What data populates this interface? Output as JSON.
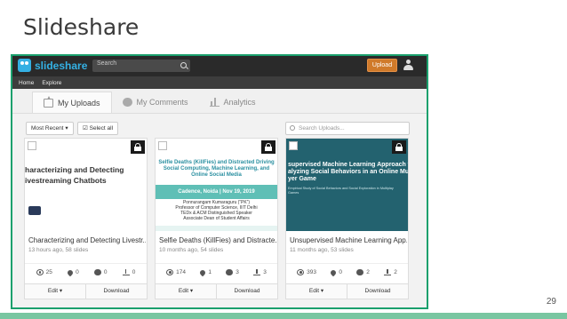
{
  "slide": {
    "title": "Slideshare",
    "page_number": "29"
  },
  "topbar": {
    "logo_text": "slideshare",
    "search_placeholder": "Search",
    "upload_label": "Upload"
  },
  "nav": {
    "items": [
      "Home",
      "Explore"
    ]
  },
  "tabs": [
    {
      "label": "My Uploads",
      "icon": "upload-icon",
      "active": true
    },
    {
      "label": "My Comments",
      "icon": "comments-icon",
      "active": false
    },
    {
      "label": "Analytics",
      "icon": "analytics-icon",
      "active": false
    }
  ],
  "controls": {
    "sort_label": "Most Recent",
    "select_all_label": "Select all",
    "search_uploads_placeholder": "Search Uploads..."
  },
  "cards": [
    {
      "title": "Characterizing and Detecting Livestr...",
      "meta": "13 hours ago, 58 slides",
      "views": "25",
      "likes": "0",
      "comments": "0",
      "downloads": "0",
      "thumb_line1": "haracterizing and Detecting",
      "thumb_line2": "ivestreaming Chatbots",
      "edit_label": "Edit",
      "download_label": "Download"
    },
    {
      "title": "Selfie Deaths (KillFies) and Distracte...",
      "meta": "10 months ago, 54 slides",
      "views": "174",
      "likes": "1",
      "comments": "3",
      "downloads": "3",
      "thumb_title": "Selfie Deaths (KillFies) and Distracted Driving Social Computing, Machine Learning, and Online Social Media",
      "thumb_band": "Cadence, Noida | Nov 19, 2019",
      "thumb_info1": "Ponnurangam Kumaraguru (“PK”)",
      "thumb_info2": "Professor of Computer Science, IIIT Delhi",
      "thumb_info3": "TEDx & ACM Distinguished Speaker",
      "thumb_info4": "Associate Dean of Student Affairs",
      "edit_label": "Edit",
      "download_label": "Download"
    },
    {
      "title": "Unsupervised Machine Learning App...",
      "meta": "11 months ago, 53 slides",
      "views": "393",
      "likes": "0",
      "comments": "2",
      "downloads": "2",
      "thumb_line1": "supervised Machine Learning Approach to",
      "thumb_line2": "alyzing Social Behaviors in an Online Multi",
      "thumb_line3": "yer Game",
      "thumb_sub1": "Empirical Study of Social Behaviors and Social Exploration in Multiplay",
      "thumb_sub2": "Games",
      "edit_label": "Edit",
      "download_label": "Download"
    }
  ]
}
